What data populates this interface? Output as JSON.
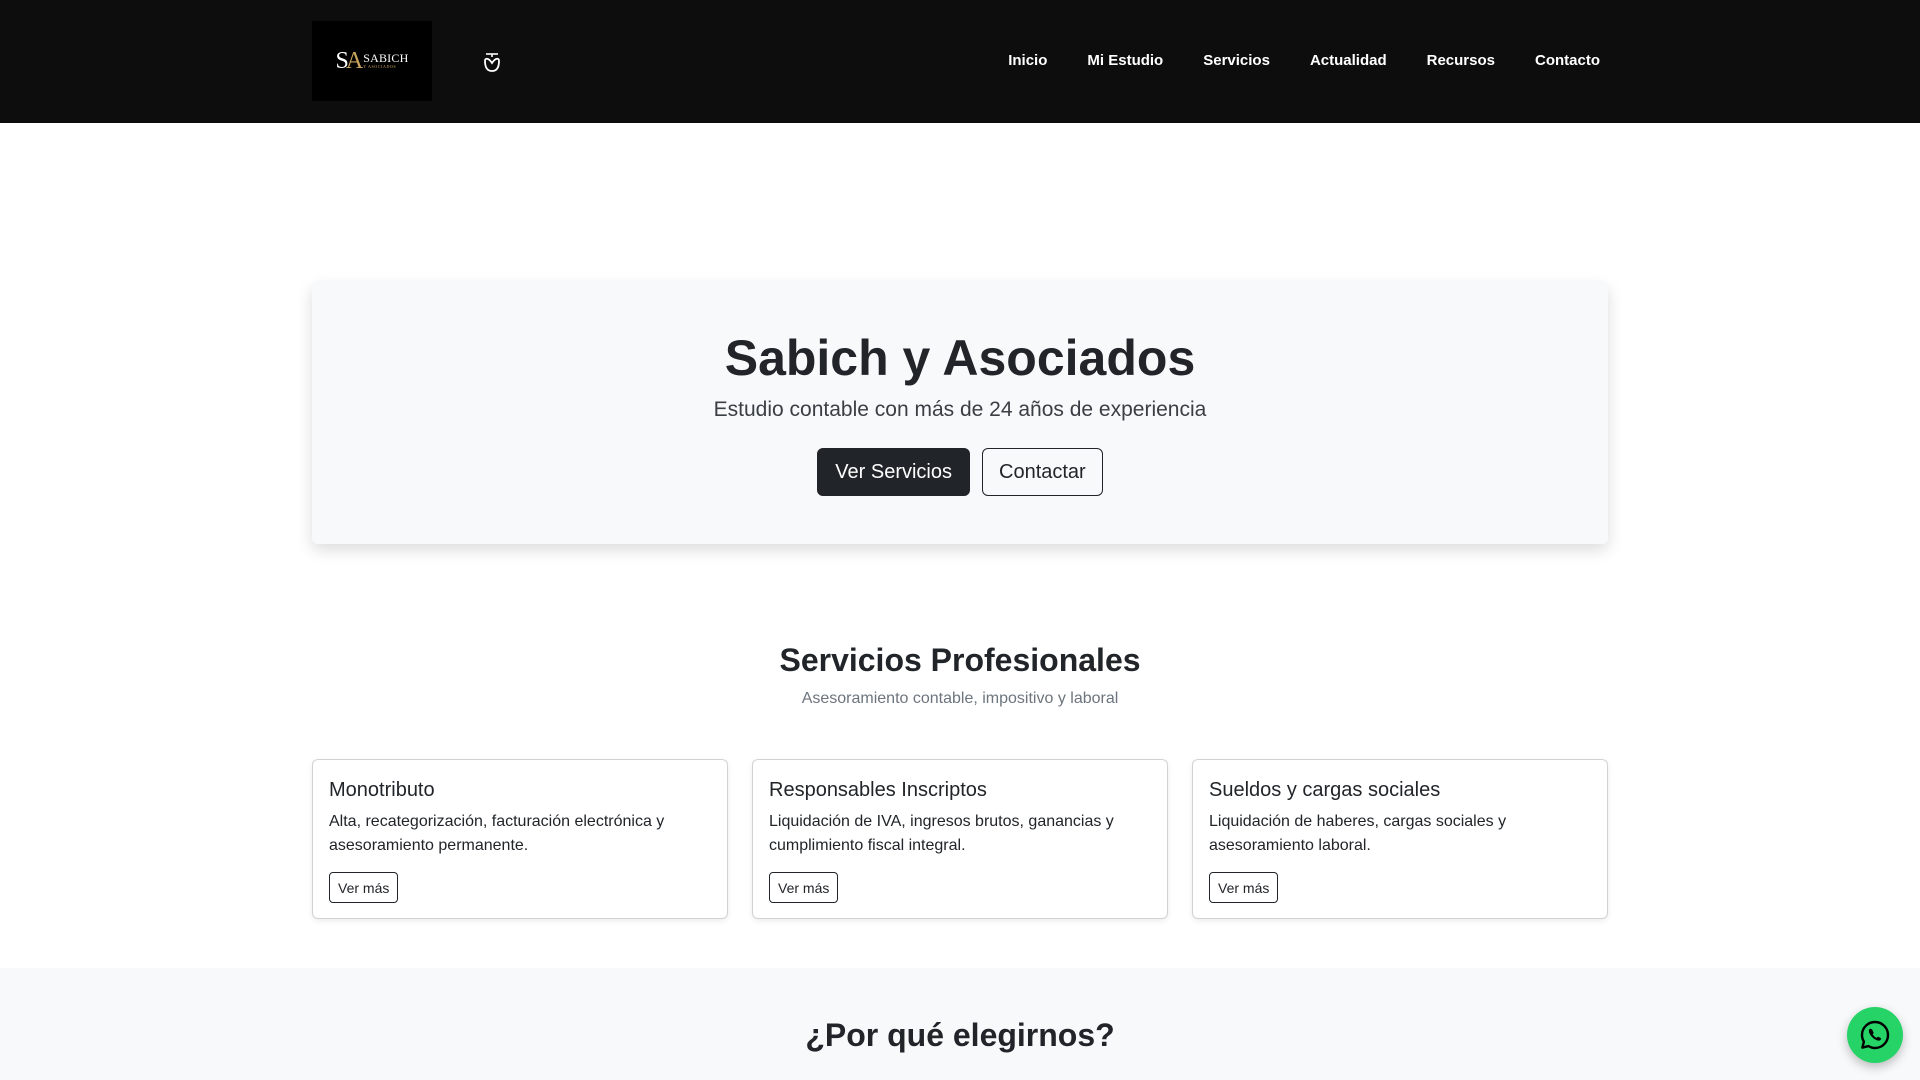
{
  "navbar": {
    "logo": {
      "mark": "SA",
      "name": "SABICH",
      "subtitle": "Y ASOCIADOS"
    },
    "icon": "cup-icon",
    "links": [
      "Inicio",
      "Mi Estudio",
      "Servicios",
      "Actualidad",
      "Recursos",
      "Contacto"
    ]
  },
  "hero": {
    "title": "Sabich y Asociados",
    "subtitle": "Estudio contable con más de 24 años de experiencia",
    "primary_button": "Ver Servicios",
    "secondary_button": "Contactar"
  },
  "services": {
    "title": "Servicios Profesionales",
    "subtitle": "Asesoramiento contable, impositivo y laboral",
    "cards": [
      {
        "title": "Monotributo",
        "text": "Alta, recategorización, facturación electrónica y asesoramiento permanente.",
        "button": "Ver más"
      },
      {
        "title": "Responsables Inscriptos",
        "text": "Liquidación de IVA, ingresos brutos, ganancias y cumplimiento fiscal integral.",
        "button": "Ver más"
      },
      {
        "title": "Sueldos y cargas sociales",
        "text": "Liquidación de haberes, cargas sociales y asesoramiento laboral.",
        "button": "Ver más"
      }
    ]
  },
  "why": {
    "title": "¿Por qué elegirnos?"
  },
  "whatsapp": {
    "icon": "whatsapp-icon"
  },
  "colors": {
    "navbar": "#0d0d0d",
    "logo_gold": "#c9a45c",
    "dark": "#212529",
    "whatsapp": "#25d366",
    "light_bg": "#f8f9fa"
  }
}
